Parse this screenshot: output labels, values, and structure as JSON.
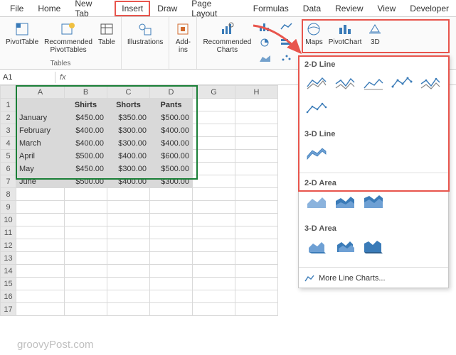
{
  "tabs": [
    "File",
    "Home",
    "New Tab",
    "Insert",
    "Draw",
    "Page Layout",
    "Formulas",
    "Data",
    "Review",
    "View",
    "Developer"
  ],
  "activeTab": "Insert",
  "ribbon": {
    "pivotTable": "PivotTable",
    "recommendedPivot": "Recommended\nPivotTables",
    "table": "Table",
    "groupTables": "Tables",
    "illustrations": "Illustrations",
    "addins": "Add-\nins",
    "recommendedCharts": "Recommended\nCharts",
    "maps": "Maps",
    "pivotChart": "PivotChart",
    "threeD": "3D"
  },
  "namebox": "A1",
  "fx": "fx",
  "columns": [
    "A",
    "B",
    "C",
    "D",
    "G",
    "H"
  ],
  "rows": [
    "1",
    "2",
    "3",
    "4",
    "5",
    "6",
    "7",
    "8",
    "9",
    "10",
    "11",
    "12",
    "13",
    "14",
    "15",
    "16",
    "17"
  ],
  "headers": [
    "",
    "Shirts",
    "Shorts",
    "Pants"
  ],
  "data": [
    [
      "January",
      "$450.00",
      "$350.00",
      "$500.00"
    ],
    [
      "February",
      "$400.00",
      "$300.00",
      "$400.00"
    ],
    [
      "March",
      "$400.00",
      "$300.00",
      "$400.00"
    ],
    [
      "April",
      "$500.00",
      "$400.00",
      "$600.00"
    ],
    [
      "May",
      "$450.00",
      "$300.00",
      "$500.00"
    ],
    [
      "June",
      "$500.00",
      "$400.00",
      "$300.00"
    ]
  ],
  "dropdown": {
    "sec1": "2-D Line",
    "sec2": "3-D Line",
    "sec3": "2-D Area",
    "sec4": "3-D Area",
    "more": "More Line Charts..."
  },
  "watermark": "groovyPost.com",
  "chart_data": {
    "type": "table",
    "categories": [
      "January",
      "February",
      "March",
      "April",
      "May",
      "June"
    ],
    "series": [
      {
        "name": "Shirts",
        "values": [
          450,
          400,
          400,
          500,
          450,
          500
        ]
      },
      {
        "name": "Shorts",
        "values": [
          350,
          300,
          300,
          400,
          300,
          400
        ]
      },
      {
        "name": "Pants",
        "values": [
          500,
          400,
          400,
          600,
          500,
          300
        ]
      }
    ],
    "title": "",
    "xlabel": "",
    "ylabel": ""
  }
}
